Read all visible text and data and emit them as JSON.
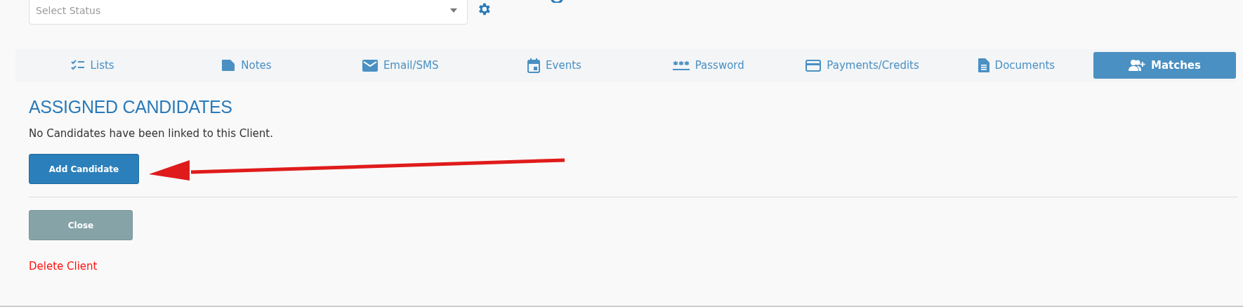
{
  "status_select": {
    "placeholder": "Select Status"
  },
  "tabs": [
    {
      "label": "Lists",
      "kind": "lists",
      "selected": false
    },
    {
      "label": "Notes",
      "kind": "notes",
      "selected": false
    },
    {
      "label": "Email/SMS",
      "kind": "email",
      "selected": false
    },
    {
      "label": "Events",
      "kind": "events",
      "selected": false
    },
    {
      "label": "Password",
      "kind": "password",
      "selected": false
    },
    {
      "label": "Payments/Credits",
      "kind": "card",
      "selected": false
    },
    {
      "label": "Documents",
      "kind": "document",
      "selected": false
    },
    {
      "label": "Matches",
      "kind": "users",
      "selected": true
    }
  ],
  "section": {
    "title": "ASSIGNED CANDIDATES",
    "message": "No Candidates have been linked to this Client.",
    "add_button": "Add Candidate"
  },
  "close_button": "Close",
  "delete_link": "Delete Client"
}
